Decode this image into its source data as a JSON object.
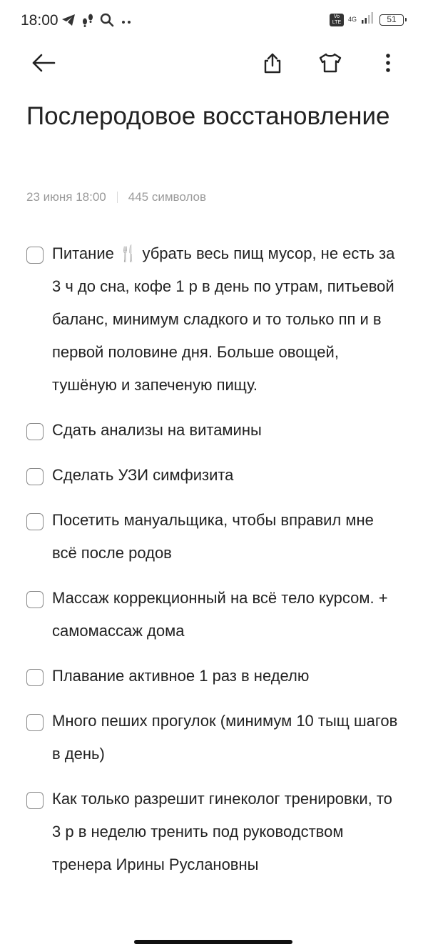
{
  "status_bar": {
    "time": "18:00",
    "left_icons": [
      "telegram-icon",
      "step-counter-icon",
      "search-icon",
      "more-dots-icon"
    ],
    "volte": "Vo LTE",
    "network": "4G",
    "battery": "51"
  },
  "toolbar": {
    "back_icon": "arrow-left-icon",
    "share_icon": "share-icon",
    "theme_icon": "tshirt-icon",
    "more_icon": "vertical-dots-icon"
  },
  "note": {
    "title": "Послеродовое восстановление",
    "date": "23 июня 18:00",
    "char_count": "445 символов"
  },
  "checklist": [
    {
      "text": "Питание 🍴 убрать весь пищ мусор, не есть за 3 ч до сна, кофе 1 р в день по утрам, питьевой баланс, минимум сладкого и то только пп и в первой половине дня. Больше овощей, тушёную и запеченую пищу.",
      "checked": false
    },
    {
      "text": "Сдать анализы на витамины",
      "checked": false
    },
    {
      "text": "Сделать УЗИ симфизита",
      "checked": false
    },
    {
      "text": "Посетить мануальщика, чтобы вправил мне всё после родов",
      "checked": false
    },
    {
      "text": "Массаж коррекционный на всё тело курсом. + самомассаж дома",
      "checked": false
    },
    {
      "text": "Плавание активное 1 раз в неделю",
      "checked": false
    },
    {
      "text": "Много пеших прогулок (минимум 10 тыщ шагов в день)",
      "checked": false
    },
    {
      "text": "Как только разрешит гинеколог тренировки, то 3 р в неделю тренить под руководством тренера Ирины Руслановны",
      "checked": false
    }
  ],
  "colors": {
    "text": "#222222",
    "meta": "#9a9a9a",
    "checkbox_border": "#8a8a8a"
  }
}
